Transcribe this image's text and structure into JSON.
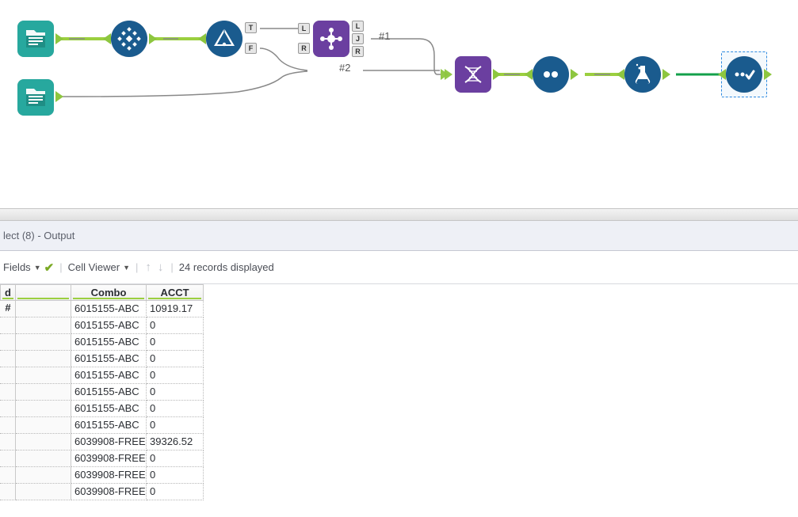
{
  "canvas": {
    "annotations": {
      "a1": "#1",
      "a2": "#2"
    },
    "join_ports": {
      "top": "T",
      "bottom": "F"
    },
    "joinmult_ports": {
      "l": "L",
      "j": "J",
      "r": "R"
    }
  },
  "panel": {
    "title": "lect (8) - Output",
    "toolbar": {
      "fields_label": "Fields",
      "cell_viewer_label": "Cell Viewer",
      "records_label": "24 records displayed"
    }
  },
  "grid": {
    "headers": [
      "d #",
      "",
      "Combo",
      "ACCT"
    ],
    "rows": [
      {
        "c1": "",
        "c2": "6015155-ABC",
        "c3": "10919.17"
      },
      {
        "c1": "",
        "c2": "6015155-ABC",
        "c3": "0"
      },
      {
        "c1": "",
        "c2": "6015155-ABC",
        "c3": "0"
      },
      {
        "c1": "",
        "c2": "6015155-ABC",
        "c3": "0"
      },
      {
        "c1": "",
        "c2": "6015155-ABC",
        "c3": "0"
      },
      {
        "c1": "",
        "c2": "6015155-ABC",
        "c3": "0"
      },
      {
        "c1": "",
        "c2": "6015155-ABC",
        "c3": "0"
      },
      {
        "c1": "",
        "c2": "6015155-ABC",
        "c3": "0"
      },
      {
        "c1": "",
        "c2": "6039908-FREE",
        "c3": "39326.52"
      },
      {
        "c1": "",
        "c2": "6039908-FREE",
        "c3": "0"
      },
      {
        "c1": "",
        "c2": "6039908-FREE",
        "c3": "0"
      },
      {
        "c1": "",
        "c2": "6039908-FREE",
        "c3": "0"
      }
    ]
  }
}
